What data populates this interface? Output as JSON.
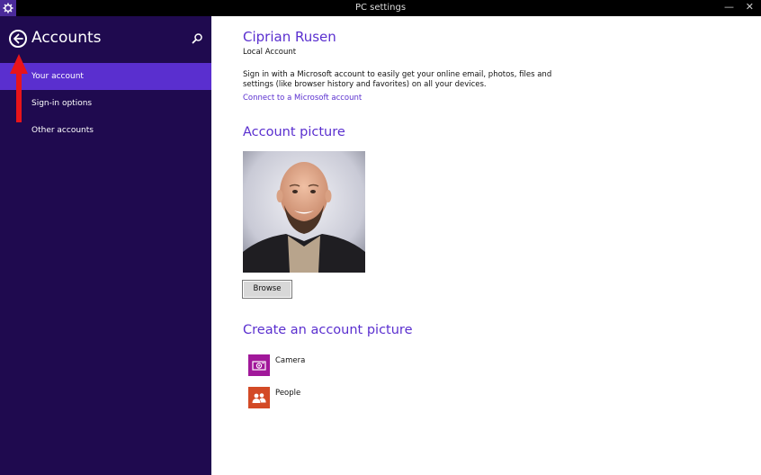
{
  "window": {
    "title": "PC settings",
    "minimize_glyph": "—",
    "close_glyph": "✕"
  },
  "sidebar": {
    "title": "Accounts",
    "items": [
      {
        "label": "Your account",
        "active": true
      },
      {
        "label": "Sign-in options",
        "active": false
      },
      {
        "label": "Other accounts",
        "active": false
      }
    ]
  },
  "account": {
    "name": "Ciprian Rusen",
    "type": "Local Account",
    "description": "Sign in with a Microsoft account to easily get your online email, photos, files and settings (like browser history and favorites) on all your devices.",
    "connect_link": "Connect to a Microsoft account"
  },
  "picture_section": {
    "heading": "Account picture",
    "browse_label": "Browse"
  },
  "create_section": {
    "heading": "Create an account picture",
    "options": [
      {
        "label": "Camera",
        "icon": "camera-icon",
        "color": "#a1189a"
      },
      {
        "label": "People",
        "icon": "people-icon",
        "color": "#d34a26"
      }
    ]
  },
  "colors": {
    "accent": "#5a2fcf",
    "sidebar_bg": "#1f0a4f",
    "annotation_arrow": "#e8141a"
  }
}
